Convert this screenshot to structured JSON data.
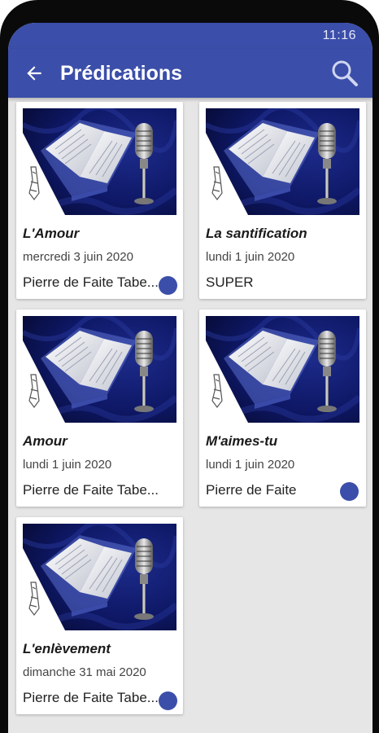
{
  "status_bar": {
    "time": "11:16"
  },
  "app_bar": {
    "title": "Prédications",
    "back_icon": "arrow-back-icon",
    "search_icon": "search-icon"
  },
  "colors": {
    "primary": "#3b4ea9",
    "background": "#e6e6e6",
    "card": "#ffffff"
  },
  "sermons": [
    {
      "title": "L'Amour",
      "date": "mercredi 3 juin 2020",
      "author": "Pierre de Faite Tabe...",
      "unread": true
    },
    {
      "title": "La santification",
      "date": "lundi 1 juin 2020",
      "author": "SUPER",
      "unread": false
    },
    {
      "title": "Amour",
      "date": "lundi 1 juin 2020",
      "author": "Pierre de Faite Tabe...",
      "unread": false
    },
    {
      "title": "M'aimes-tu",
      "date": "lundi 1 juin 2020",
      "author": "Pierre de Faite",
      "unread": true
    },
    {
      "title": "L'enlèvement",
      "date": "dimanche 31 mai 2020",
      "author": "Pierre de Faite Tabe...",
      "unread": true
    }
  ]
}
